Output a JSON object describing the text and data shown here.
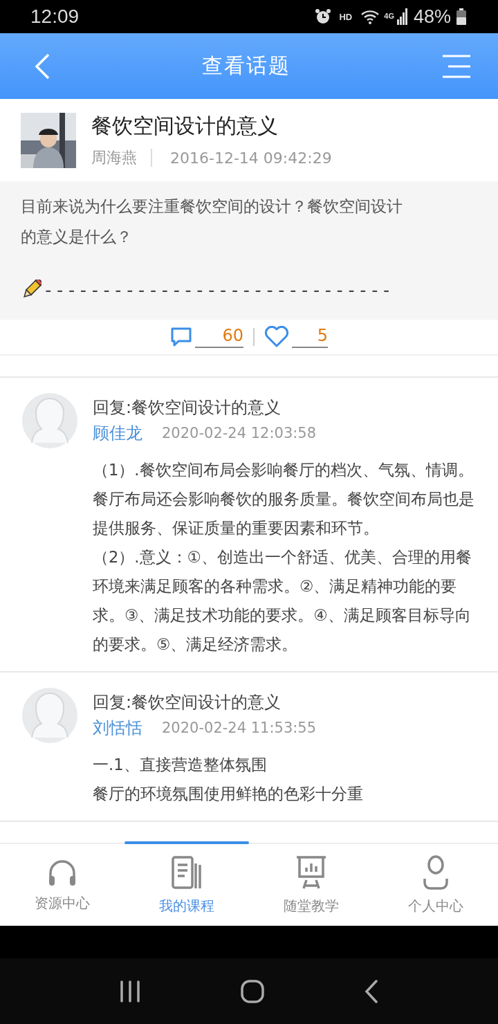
{
  "status_bar": {
    "time": "12:09",
    "hd": "HD",
    "network": "4G",
    "battery": "48%"
  },
  "header": {
    "title": "查看话题"
  },
  "post": {
    "title": "餐饮空间设计的意义",
    "author": "周海燕",
    "date": "2016-12-14 09:42:29",
    "body": "目前来说为什么要注重餐饮空间的设计？餐饮空间设计的意义是什么？",
    "signature": "------------------------------",
    "comments": "60",
    "likes": "5"
  },
  "replies": [
    {
      "title": "回复:餐饮空间设计的意义",
      "author": "顾佳龙",
      "date": "2020-02-24 12:03:58",
      "paragraphs": [
        "（1）.餐饮空间布局会影响餐厅的档次、气氛、情调。餐厅布局还会影响餐饮的服务质量。餐饮空间布局也是提供服务、保证质量的重要因素和环节。",
        "（2）.意义：①、创造出一个舒适、优美、合理的用餐环境来满足顾客的各种需求。②、满足精神功能的要求。③、满足技术功能的要求。④、满足顾客目标导向的要求。⑤、满足经济需求。"
      ]
    },
    {
      "title": "回复:餐饮空间设计的意义",
      "author": "刘恬恬",
      "date": "2020-02-24 11:53:55",
      "paragraphs": [
        "一.1、直接营造整体氛围",
        "餐厅的环境氛围使用鲜艳的色彩十分重"
      ]
    }
  ],
  "tabs": [
    {
      "label": "资源中心",
      "selected": false
    },
    {
      "label": "我的课程",
      "selected": true
    },
    {
      "label": "随堂教学",
      "selected": false
    },
    {
      "label": "个人中心",
      "selected": false
    }
  ]
}
